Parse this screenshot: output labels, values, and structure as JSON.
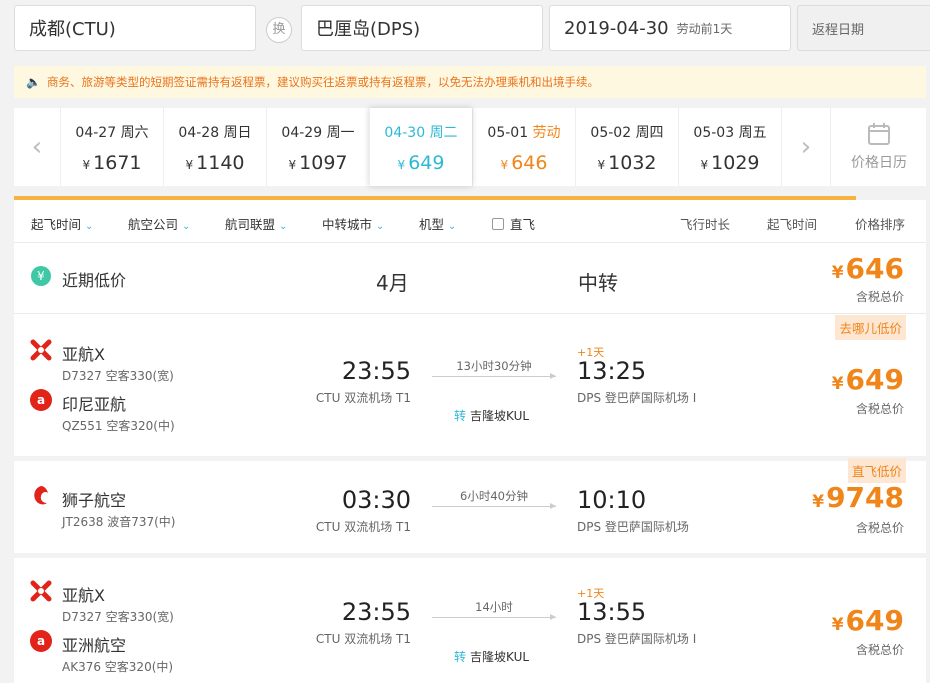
{
  "search": {
    "from": "成都(CTU)",
    "swap": "换",
    "to": "巴厘岛(DPS)",
    "date": "2019-04-30",
    "date_note": "劳动前1天",
    "return_placeholder": "返程日期"
  },
  "notice": {
    "text": "商务、旅游等类型的短期签证需持有返程票，建议购买往返票或持有返程票，以免无法办理乘机和出境手续。"
  },
  "date_strip": {
    "days": [
      {
        "date": "04-27",
        "weekday": "周六",
        "price": "1671"
      },
      {
        "date": "04-28",
        "weekday": "周日",
        "price": "1140"
      },
      {
        "date": "04-29",
        "weekday": "周一",
        "price": "1097"
      },
      {
        "date": "04-30",
        "weekday": "周二",
        "price": "649"
      },
      {
        "date": "05-01",
        "weekday": "劳动",
        "price": "646"
      },
      {
        "date": "05-02",
        "weekday": "周四",
        "price": "1032"
      },
      {
        "date": "05-03",
        "weekday": "周五",
        "price": "1029"
      }
    ],
    "currency": "¥",
    "calendar_label": "价格日历"
  },
  "filters": {
    "depart_time": "起飞时间",
    "airline": "航空公司",
    "alliance": "航司联盟",
    "transfer_city": "中转城市",
    "aircraft": "机型",
    "direct": "直飞",
    "sort_duration": "飞行时长",
    "sort_depart": "起飞时间",
    "sort_price": "价格排序"
  },
  "low_price": {
    "label": "近期低价",
    "month": "4月",
    "type": "中转",
    "price": "646",
    "tax": "含税总价"
  },
  "flights": [
    {
      "airline1": "亚航X",
      "flight1": "D7327 空客330(宽)",
      "airline2": "印尼亚航",
      "flight2": "QZ551 空客320(中)",
      "dep_time": "23:55",
      "dep_airport": "CTU 双流机场 T1",
      "duration": "13小时30分钟",
      "transfer_tag": "转",
      "transfer_city": "吉隆坡KUL",
      "plus_day": "+1天",
      "arr_time": "13:25",
      "arr_airport": "DPS 登巴萨国际机场 I",
      "badge": "去哪儿低价",
      "price": "649",
      "tax": "含税总价"
    },
    {
      "airline1": "狮子航空",
      "flight1": "JT2638 波音737(中)",
      "dep_time": "03:30",
      "dep_airport": "CTU 双流机场 T1",
      "duration": "6小时40分钟",
      "arr_time": "10:10",
      "arr_airport": "DPS 登巴萨国际机场",
      "badge": "直飞低价",
      "price": "9748",
      "tax": "含税总价"
    },
    {
      "airline1": "亚航X",
      "flight1": "D7327 空客330(宽)",
      "airline2": "亚洲航空",
      "flight2": "AK376 空客320(中)",
      "dep_time": "23:55",
      "dep_airport": "CTU 双流机场 T1",
      "duration": "14小时",
      "transfer_tag": "转",
      "transfer_city": "吉隆坡KUL",
      "plus_day": "+1天",
      "arr_time": "13:55",
      "arr_airport": "DPS 登巴萨国际机场 I",
      "price": "649",
      "tax": "含税总价"
    }
  ],
  "colors": {
    "accent": "#2eb8d6",
    "price": "#f08519",
    "airasia_red": "#e2231a"
  }
}
